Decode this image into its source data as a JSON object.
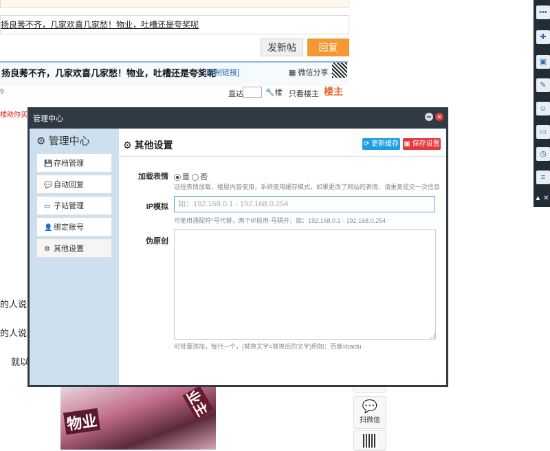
{
  "forum": {
    "thread_link": "扬良莠不齐，几家欢喜几家愁！物业，吐槽还是夸奖呢",
    "btn_post": "发新帖",
    "btn_reply": "回复",
    "post_title": "扬良莠不齐，几家欢喜几家愁！物业，吐槽还是夸奖呢",
    "copy_link": "[复制链接]",
    "wechat_share": "微信分享→",
    "number": "9",
    "zhida": "直达",
    "wrench_label": "楼",
    "only_author": "只看楼主",
    "louzhu": "楼主",
    "red_line": "楼助你买房",
    "side_text1": "的人说",
    "side_text2": "的人说",
    "side_text3": "就以",
    "photo_label1": "物业",
    "photo_label2": "业主",
    "widget_wechat": "扫微信"
  },
  "right_toolbar": {
    "icons": [
      "chat-icon",
      "add-icon",
      "screen-icon",
      "edit-icon",
      "user-icon",
      "monitor-icon",
      "clock-icon",
      "text-icon"
    ],
    "bottom_label": "▲ ✕"
  },
  "modal": {
    "window_title": "管理中心",
    "sidebar": {
      "heading": "管理中心",
      "items": [
        {
          "label": "存档管理",
          "icon": "save-icon"
        },
        {
          "label": "自动回复",
          "icon": "comment-icon"
        },
        {
          "label": "子站管理",
          "icon": "monitor-icon"
        },
        {
          "label": "绑定账号",
          "icon": "user-icon"
        },
        {
          "label": "其他设置",
          "icon": "gear-icon"
        }
      ],
      "active_index": 4
    },
    "content": {
      "title": "其他设置",
      "btn_refresh": "更新缓存",
      "btn_save": "保存设置",
      "fields": {
        "emoji_label": "加载表情",
        "emoji_yes": "是",
        "emoji_no": "否",
        "emoji_selected": "是",
        "emoji_help": "远程表情加载，楼层内容使用，系统使用缓存模式，如果更改了网站的表情，请重复提交一次信息",
        "ip_label": "IP模拟",
        "ip_placeholder": "如：192.168.0.1 - 192.168.0.254",
        "ip_help": "可使用通配符*号代替，两个IP段用-号隔开，如：192.168.0.1 - 192.168.0.254",
        "fake_label": "伪原创",
        "fake_value": "",
        "fake_help": "可批量添加，每行一个，(替换文字=替换后的文字)例如：百度=baidu"
      }
    }
  }
}
